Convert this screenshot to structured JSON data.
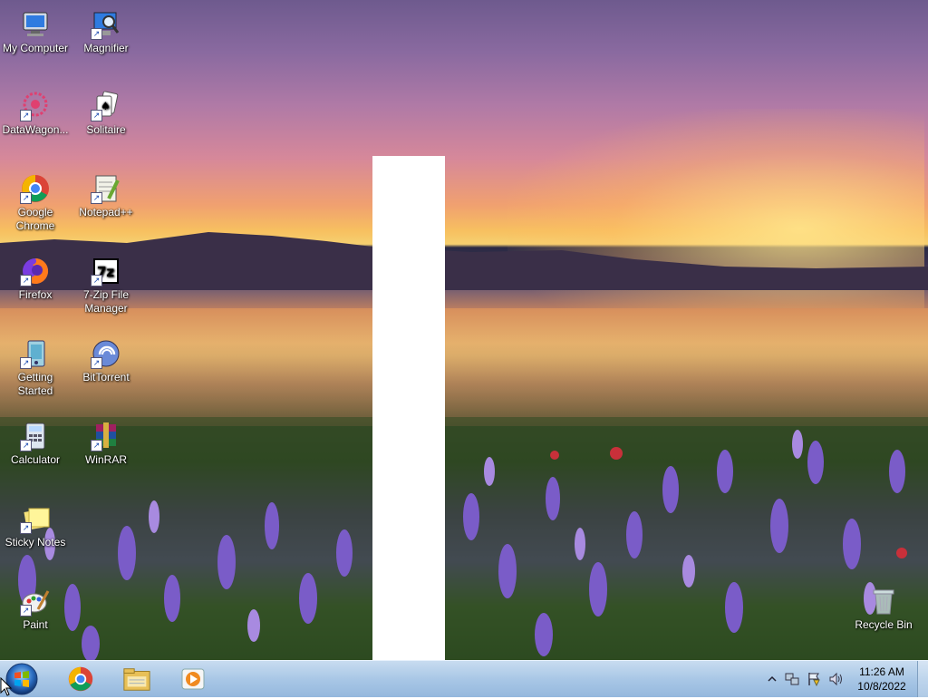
{
  "desktop": {
    "icons": [
      {
        "label": "My Computer",
        "icon": "computer-icon"
      },
      {
        "label": "Magnifier",
        "icon": "magnifier-icon"
      },
      {
        "label": "DataWagon...",
        "icon": "datawagon-icon"
      },
      {
        "label": "Solitaire",
        "icon": "solitaire-icon"
      },
      {
        "label": "Google Chrome",
        "icon": "chrome-icon"
      },
      {
        "label": "Notepad++",
        "icon": "notepadpp-icon"
      },
      {
        "label": "Firefox",
        "icon": "firefox-icon"
      },
      {
        "label": "7-Zip File Manager",
        "icon": "7zip-icon"
      },
      {
        "label": "Getting Started",
        "icon": "getting-started-icon"
      },
      {
        "label": "BitTorrent",
        "icon": "bittorrent-icon"
      },
      {
        "label": "Calculator",
        "icon": "calculator-icon"
      },
      {
        "label": "WinRAR",
        "icon": "winrar-icon"
      },
      {
        "label": "Sticky Notes",
        "icon": "sticky-notes-icon"
      },
      {
        "label": "Paint",
        "icon": "paint-icon"
      },
      {
        "label": "Recycle Bin",
        "icon": "recycle-bin-icon"
      }
    ]
  },
  "taskbar": {
    "pinned": [
      "chrome-icon",
      "file-explorer-icon",
      "media-player-icon"
    ],
    "clock": {
      "time": "11:26 AM",
      "date": "10/8/2022"
    }
  },
  "colors": {
    "taskbar": "#a9c7e6",
    "window": "#ffffff"
  }
}
